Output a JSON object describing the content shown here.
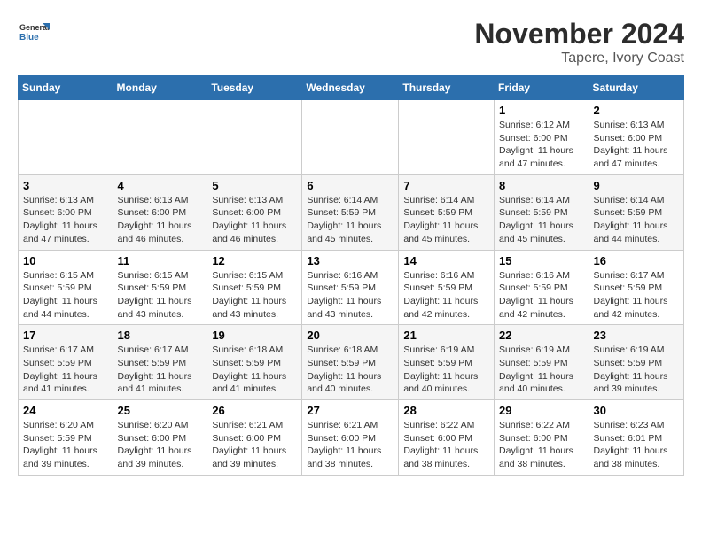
{
  "logo": {
    "text_general": "General",
    "text_blue": "Blue"
  },
  "title": "November 2024",
  "location": "Tapere, Ivory Coast",
  "weekdays": [
    "Sunday",
    "Monday",
    "Tuesday",
    "Wednesday",
    "Thursday",
    "Friday",
    "Saturday"
  ],
  "weeks": [
    [
      {
        "day": "",
        "info": ""
      },
      {
        "day": "",
        "info": ""
      },
      {
        "day": "",
        "info": ""
      },
      {
        "day": "",
        "info": ""
      },
      {
        "day": "",
        "info": ""
      },
      {
        "day": "1",
        "info": "Sunrise: 6:12 AM\nSunset: 6:00 PM\nDaylight: 11 hours and 47 minutes."
      },
      {
        "day": "2",
        "info": "Sunrise: 6:13 AM\nSunset: 6:00 PM\nDaylight: 11 hours and 47 minutes."
      }
    ],
    [
      {
        "day": "3",
        "info": "Sunrise: 6:13 AM\nSunset: 6:00 PM\nDaylight: 11 hours and 47 minutes."
      },
      {
        "day": "4",
        "info": "Sunrise: 6:13 AM\nSunset: 6:00 PM\nDaylight: 11 hours and 46 minutes."
      },
      {
        "day": "5",
        "info": "Sunrise: 6:13 AM\nSunset: 6:00 PM\nDaylight: 11 hours and 46 minutes."
      },
      {
        "day": "6",
        "info": "Sunrise: 6:14 AM\nSunset: 5:59 PM\nDaylight: 11 hours and 45 minutes."
      },
      {
        "day": "7",
        "info": "Sunrise: 6:14 AM\nSunset: 5:59 PM\nDaylight: 11 hours and 45 minutes."
      },
      {
        "day": "8",
        "info": "Sunrise: 6:14 AM\nSunset: 5:59 PM\nDaylight: 11 hours and 45 minutes."
      },
      {
        "day": "9",
        "info": "Sunrise: 6:14 AM\nSunset: 5:59 PM\nDaylight: 11 hours and 44 minutes."
      }
    ],
    [
      {
        "day": "10",
        "info": "Sunrise: 6:15 AM\nSunset: 5:59 PM\nDaylight: 11 hours and 44 minutes."
      },
      {
        "day": "11",
        "info": "Sunrise: 6:15 AM\nSunset: 5:59 PM\nDaylight: 11 hours and 43 minutes."
      },
      {
        "day": "12",
        "info": "Sunrise: 6:15 AM\nSunset: 5:59 PM\nDaylight: 11 hours and 43 minutes."
      },
      {
        "day": "13",
        "info": "Sunrise: 6:16 AM\nSunset: 5:59 PM\nDaylight: 11 hours and 43 minutes."
      },
      {
        "day": "14",
        "info": "Sunrise: 6:16 AM\nSunset: 5:59 PM\nDaylight: 11 hours and 42 minutes."
      },
      {
        "day": "15",
        "info": "Sunrise: 6:16 AM\nSunset: 5:59 PM\nDaylight: 11 hours and 42 minutes."
      },
      {
        "day": "16",
        "info": "Sunrise: 6:17 AM\nSunset: 5:59 PM\nDaylight: 11 hours and 42 minutes."
      }
    ],
    [
      {
        "day": "17",
        "info": "Sunrise: 6:17 AM\nSunset: 5:59 PM\nDaylight: 11 hours and 41 minutes."
      },
      {
        "day": "18",
        "info": "Sunrise: 6:17 AM\nSunset: 5:59 PM\nDaylight: 11 hours and 41 minutes."
      },
      {
        "day": "19",
        "info": "Sunrise: 6:18 AM\nSunset: 5:59 PM\nDaylight: 11 hours and 41 minutes."
      },
      {
        "day": "20",
        "info": "Sunrise: 6:18 AM\nSunset: 5:59 PM\nDaylight: 11 hours and 40 minutes."
      },
      {
        "day": "21",
        "info": "Sunrise: 6:19 AM\nSunset: 5:59 PM\nDaylight: 11 hours and 40 minutes."
      },
      {
        "day": "22",
        "info": "Sunrise: 6:19 AM\nSunset: 5:59 PM\nDaylight: 11 hours and 40 minutes."
      },
      {
        "day": "23",
        "info": "Sunrise: 6:19 AM\nSunset: 5:59 PM\nDaylight: 11 hours and 39 minutes."
      }
    ],
    [
      {
        "day": "24",
        "info": "Sunrise: 6:20 AM\nSunset: 5:59 PM\nDaylight: 11 hours and 39 minutes."
      },
      {
        "day": "25",
        "info": "Sunrise: 6:20 AM\nSunset: 6:00 PM\nDaylight: 11 hours and 39 minutes."
      },
      {
        "day": "26",
        "info": "Sunrise: 6:21 AM\nSunset: 6:00 PM\nDaylight: 11 hours and 39 minutes."
      },
      {
        "day": "27",
        "info": "Sunrise: 6:21 AM\nSunset: 6:00 PM\nDaylight: 11 hours and 38 minutes."
      },
      {
        "day": "28",
        "info": "Sunrise: 6:22 AM\nSunset: 6:00 PM\nDaylight: 11 hours and 38 minutes."
      },
      {
        "day": "29",
        "info": "Sunrise: 6:22 AM\nSunset: 6:00 PM\nDaylight: 11 hours and 38 minutes."
      },
      {
        "day": "30",
        "info": "Sunrise: 6:23 AM\nSunset: 6:01 PM\nDaylight: 11 hours and 38 minutes."
      }
    ]
  ]
}
